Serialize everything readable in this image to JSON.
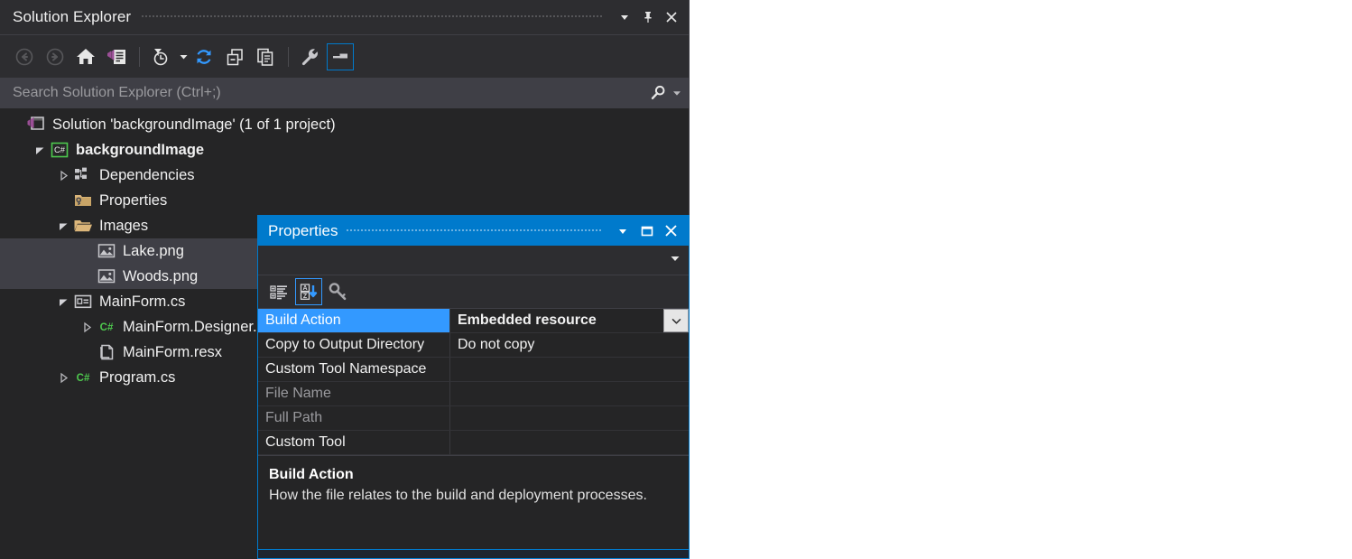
{
  "solution_explorer": {
    "title": "Solution Explorer",
    "titlebar_buttons": [
      {
        "name": "window-dropdown-icon",
        "label": ""
      },
      {
        "name": "pin-icon",
        "label": ""
      },
      {
        "name": "close-icon",
        "label": ""
      }
    ],
    "toolbar": [
      {
        "name": "back-button",
        "icon": "back-arrow-icon",
        "state": "disabled"
      },
      {
        "name": "forward-button",
        "icon": "forward-arrow-icon",
        "state": "disabled"
      },
      {
        "name": "home-button",
        "icon": "home-icon",
        "state": "normal"
      },
      {
        "name": "pending-changes-button",
        "icon": "solution-view-icon",
        "state": "normal"
      },
      {
        "name": "filter-button",
        "icon": "clock-filter-icon",
        "state": "normal"
      },
      {
        "name": "refresh-button",
        "icon": "refresh-icon",
        "state": "normal"
      },
      {
        "name": "collapse-all-button",
        "icon": "collapse-all-icon",
        "state": "normal"
      },
      {
        "name": "show-all-files-button",
        "icon": "show-all-files-icon",
        "state": "normal"
      },
      {
        "name": "properties-button",
        "icon": "wrench-icon",
        "state": "normal"
      },
      {
        "name": "preview-selected-items-button",
        "icon": "preview-pane-icon",
        "state": "selected"
      }
    ],
    "search": {
      "placeholder": "Search Solution Explorer (Ctrl+;)",
      "value": "",
      "icon": "search-icon",
      "dropdown_icon": "chevron-down-icon"
    },
    "tree": [
      {
        "label": "Solution 'backgroundImage' (1 of 1 project)",
        "icon": "solution-icon",
        "indent": 0,
        "twisty": "none",
        "bold": false,
        "selected": false
      },
      {
        "label": "backgroundImage",
        "icon": "csharp-project-icon",
        "indent": 1,
        "twisty": "expanded",
        "bold": true,
        "selected": false
      },
      {
        "label": "Dependencies",
        "icon": "dependencies-icon",
        "indent": 2,
        "twisty": "collapsed",
        "bold": false,
        "selected": false
      },
      {
        "label": "Properties",
        "icon": "properties-folder-icon",
        "indent": 2,
        "twisty": "none",
        "bold": false,
        "selected": false
      },
      {
        "label": "Images",
        "icon": "folder-open-icon",
        "indent": 2,
        "twisty": "expanded",
        "bold": false,
        "selected": false
      },
      {
        "label": "Lake.png",
        "icon": "image-file-icon",
        "indent": 3,
        "twisty": "none",
        "bold": false,
        "selected": true
      },
      {
        "label": "Woods.png",
        "icon": "image-file-icon",
        "indent": 3,
        "twisty": "none",
        "bold": false,
        "selected": true
      },
      {
        "label": "MainForm.cs",
        "icon": "form-icon",
        "indent": 2,
        "twisty": "expanded",
        "bold": false,
        "selected": false
      },
      {
        "label": "MainForm.Designer.cs",
        "icon": "csharp-file-icon",
        "indent": 3,
        "twisty": "collapsed",
        "bold": false,
        "selected": false
      },
      {
        "label": "MainForm.resx",
        "icon": "resx-file-icon",
        "indent": 3,
        "twisty": "none",
        "bold": false,
        "selected": false
      },
      {
        "label": "Program.cs",
        "icon": "csharp-file-icon",
        "indent": 2,
        "twisty": "collapsed",
        "bold": false,
        "selected": false
      }
    ]
  },
  "properties_window": {
    "title": "Properties",
    "titlebar_buttons": [
      {
        "name": "window-dropdown-icon"
      },
      {
        "name": "maximize-icon"
      },
      {
        "name": "close-icon"
      }
    ],
    "object_selector": {
      "value": "",
      "dropdown_icon": "chevron-down-icon"
    },
    "toolbar": [
      {
        "name": "categorized-view-button",
        "icon": "categorized-icon",
        "state": "normal"
      },
      {
        "name": "alphabetical-view-button",
        "icon": "sort-az-icon",
        "state": "selected"
      },
      {
        "name": "properties-view-button",
        "icon": "key-icon",
        "state": "normal"
      }
    ],
    "grid": {
      "rows": [
        {
          "name": "Build Action",
          "value": "Embedded resource",
          "selected": true,
          "dim": false,
          "has_dropdown": true
        },
        {
          "name": "Copy to Output Directory",
          "value": "Do not copy",
          "selected": false,
          "dim": false,
          "has_dropdown": false
        },
        {
          "name": "Custom Tool Namespace",
          "value": "",
          "selected": false,
          "dim": false,
          "has_dropdown": false
        },
        {
          "name": "File Name",
          "value": "",
          "selected": false,
          "dim": true,
          "has_dropdown": false
        },
        {
          "name": "Full Path",
          "value": "",
          "selected": false,
          "dim": true,
          "has_dropdown": false
        },
        {
          "name": "Custom Tool",
          "value": "",
          "selected": false,
          "dim": false,
          "has_dropdown": false
        }
      ]
    },
    "description": {
      "title": "Build Action",
      "text": "How the file relates to the build and deployment processes."
    }
  },
  "colors": {
    "accent_blue": "#007acc",
    "selection_blue": "#3399ff",
    "panel_bg": "#252526",
    "chrome_bg": "#2d2d30",
    "row_selected_bg": "#3f3f46",
    "folder_gold": "#dcb67a",
    "csharp_green": "#4ec94e",
    "vs_purple": "#9b4f96"
  }
}
